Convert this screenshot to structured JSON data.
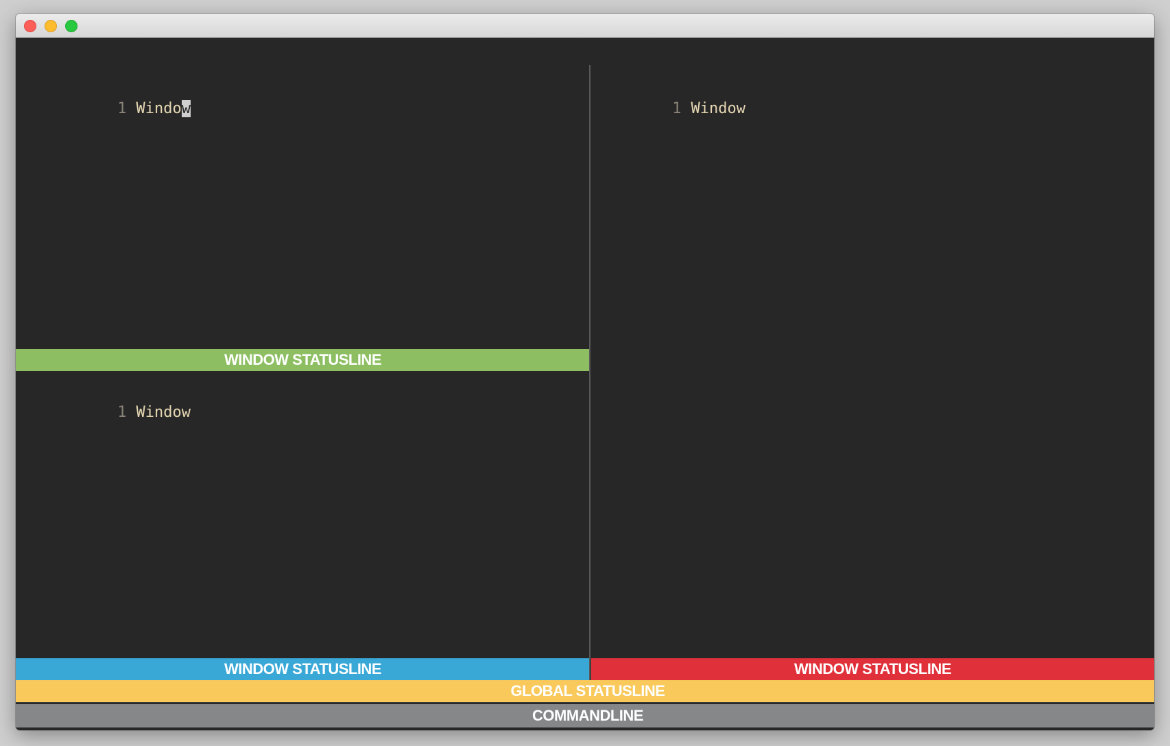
{
  "window": {
    "controls": [
      "close",
      "minimize",
      "zoom"
    ]
  },
  "panes": {
    "top_left": {
      "line_number": "1",
      "text_before_cursor": "Windo",
      "cursor_char": "w"
    },
    "bottom_left": {
      "line_number": "1",
      "text": "Window"
    },
    "right": {
      "line_number": "1",
      "text": "Window"
    }
  },
  "statuslines": {
    "top_left": "WINDOW STATUSLINE",
    "bottom_left": "WINDOW STATUSLINE",
    "right": "WINDOW STATUSLINE",
    "global": "GLOBAL STATUSLINE",
    "commandline": "COMMANDLINE"
  },
  "colors": {
    "editor_bg": "#272727",
    "top_left_statusline": "#8dbf62",
    "bottom_left_statusline": "#39a8d7",
    "right_statusline": "#e0303a",
    "global_statusline": "#f9c95c",
    "commandline": "#858789",
    "text": "#e4d6b2",
    "line_number": "#8a8478"
  }
}
